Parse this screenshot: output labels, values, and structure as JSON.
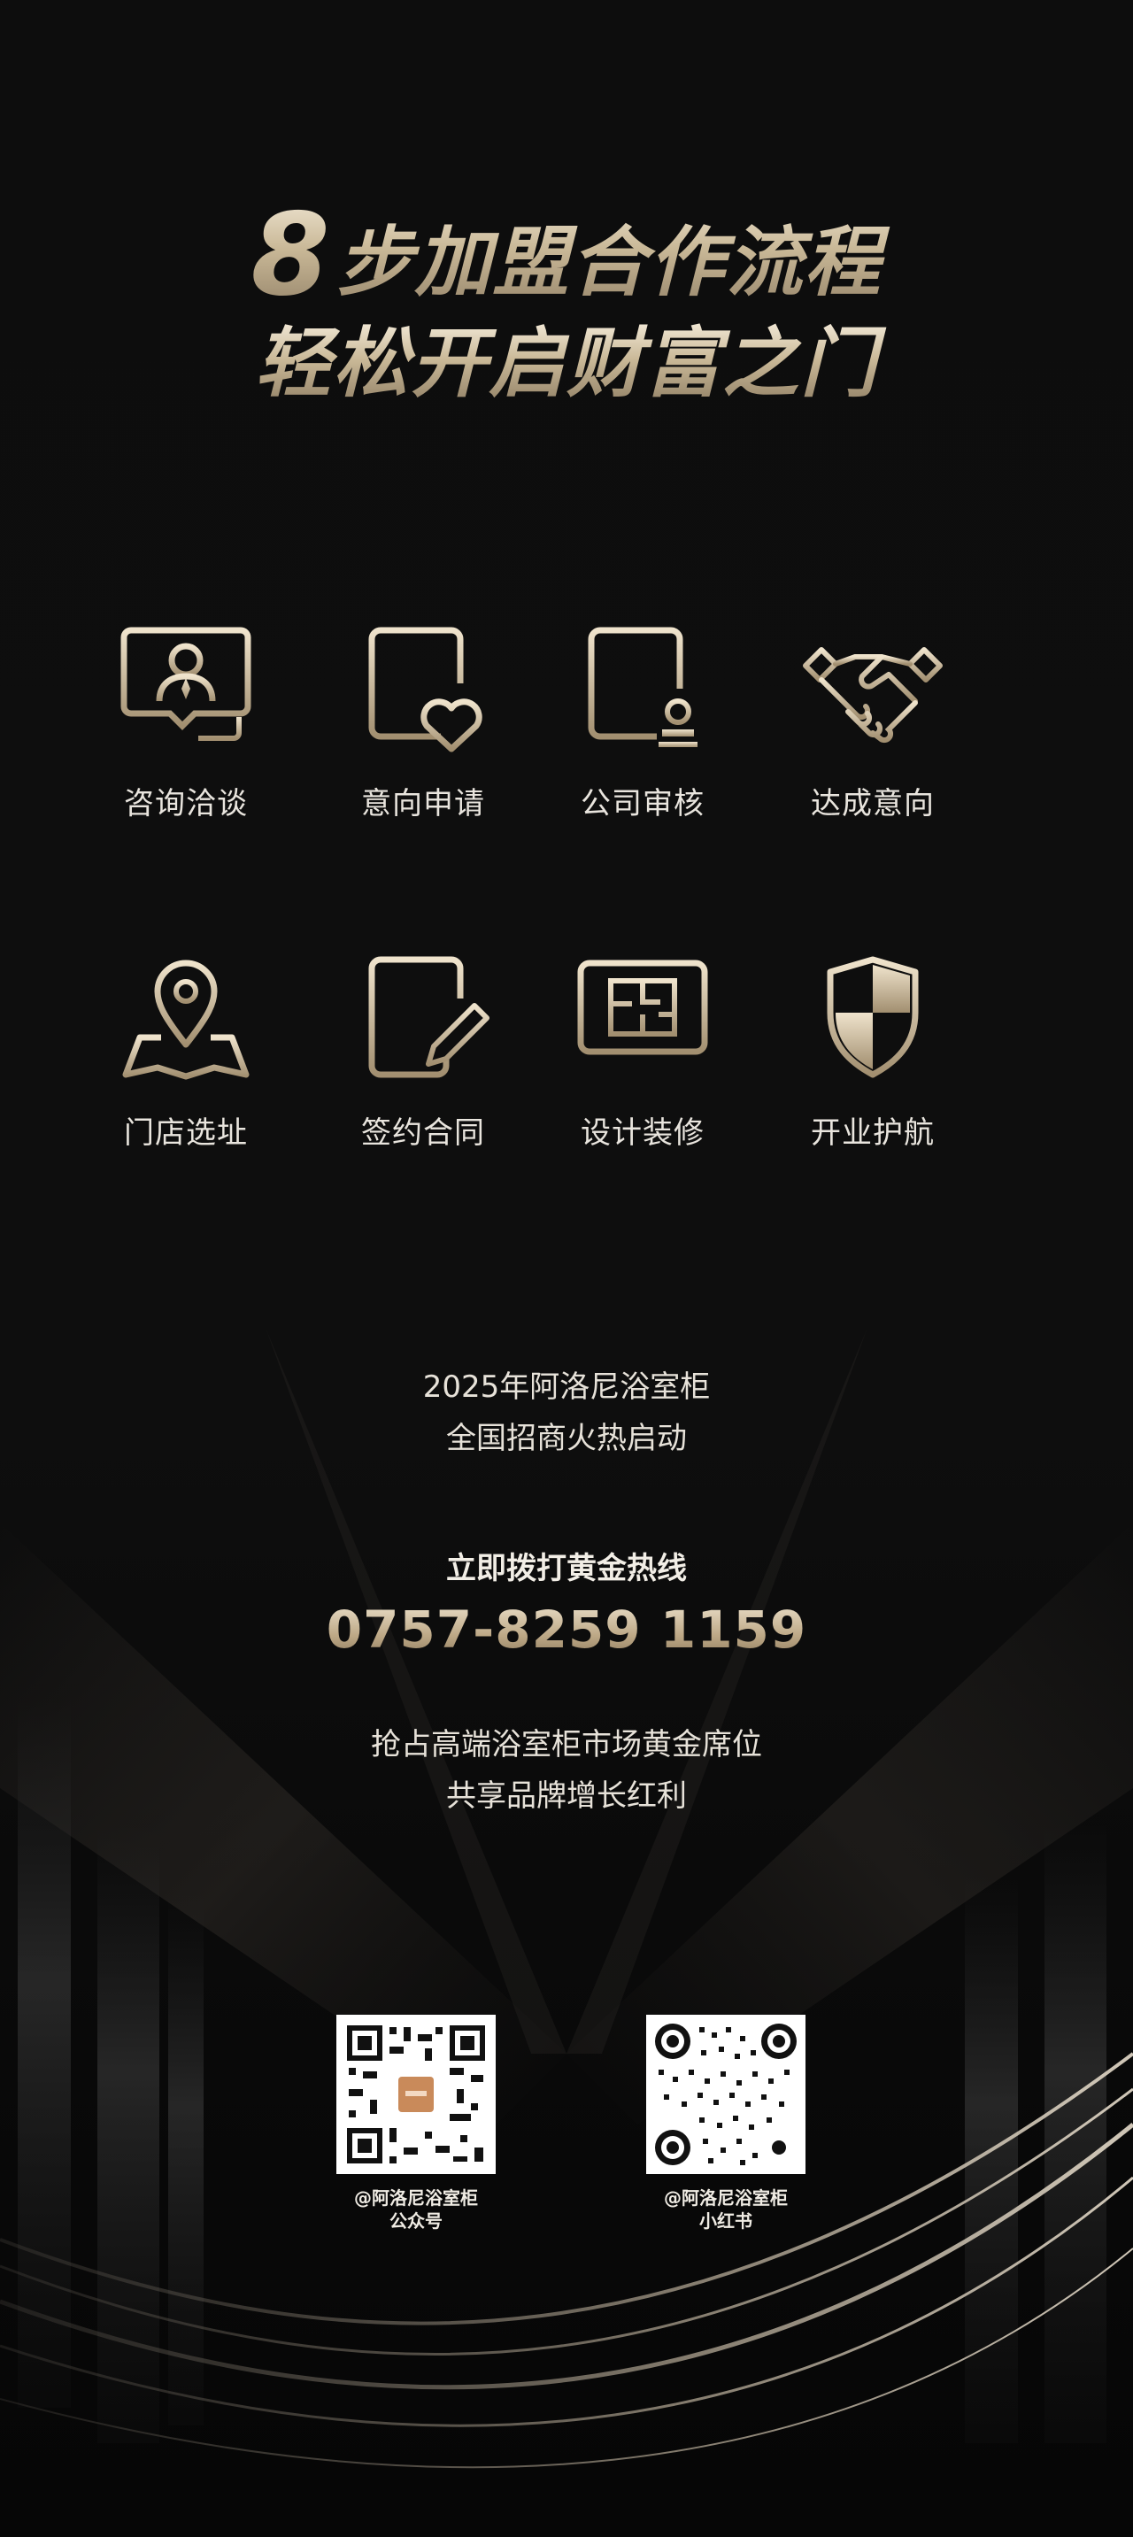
{
  "title": {
    "number": "8",
    "line1_rest": "步加盟合作流程",
    "line2": "轻松开启财富之门"
  },
  "steps": [
    {
      "label": "咨询洽谈",
      "icon": "consultation-chat-icon"
    },
    {
      "label": "意向申请",
      "icon": "application-heart-icon"
    },
    {
      "label": "公司审核",
      "icon": "review-stamp-icon"
    },
    {
      "label": "达成意向",
      "icon": "handshake-icon"
    },
    {
      "label": "门店选址",
      "icon": "location-map-icon"
    },
    {
      "label": "签约合同",
      "icon": "contract-pen-icon"
    },
    {
      "label": "设计装修",
      "icon": "floorplan-monitor-icon"
    },
    {
      "label": "开业护航",
      "icon": "shield-icon"
    }
  ],
  "promo": {
    "line1": "2025年阿洛尼浴室柜",
    "line2": "全国招商火热启动"
  },
  "hotline": {
    "title": "立即拨打黄金热线",
    "number": "0757-8259 1159"
  },
  "slogan": {
    "line1": "抢占高端浴室柜市场黄金席位",
    "line2": "共享品牌增长红利"
  },
  "qr_codes": [
    {
      "caption_line1": "@阿洛尼浴室柜",
      "caption_line2": "公众号"
    },
    {
      "caption_line1": "@阿洛尼浴室柜",
      "caption_line2": "小红书"
    }
  ],
  "colors": {
    "background": "#0b0b0b",
    "gold": "#c9b897",
    "text": "#e9e5de"
  }
}
